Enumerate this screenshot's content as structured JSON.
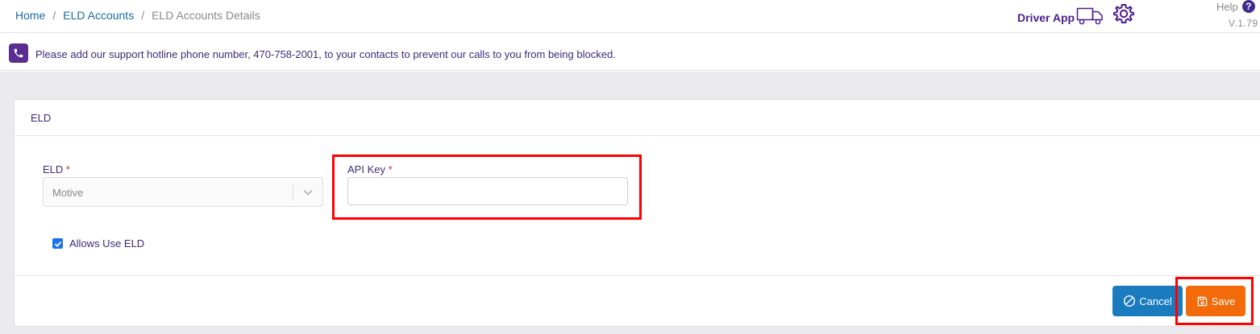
{
  "breadcrumb": {
    "home": "Home",
    "section": "ELD Accounts",
    "current": "ELD Accounts Details",
    "separator": "/"
  },
  "header": {
    "driver_app_label": "Driver App",
    "help_label": "Help",
    "help_icon_glyph": "?",
    "version": "V.1.79"
  },
  "notice": {
    "text": "Please add our support hotline phone number, 470-758-2001, to your contacts to prevent our calls to you from being blocked."
  },
  "card": {
    "title": "ELD",
    "eld_field": {
      "label": "ELD",
      "required_mark": "*",
      "value": "Motive"
    },
    "api_key_field": {
      "label": "API Key",
      "required_mark": "*",
      "value": ""
    },
    "allows_use_eld": {
      "label": "Allows Use ELD",
      "checked": true
    },
    "buttons": {
      "cancel": "Cancel",
      "save": "Save"
    }
  },
  "colors": {
    "brand_purple": "#4b1d8f",
    "link_blue": "#1a6aa3",
    "cancel_blue": "#1a7bbf",
    "save_orange": "#f26a0a",
    "highlight_red": "#ff0000"
  },
  "icons": [
    "truck-icon",
    "gear-icon",
    "help-icon",
    "phone-icon",
    "chevron-down-icon",
    "check-icon",
    "cancel-icon",
    "save-icon"
  ]
}
